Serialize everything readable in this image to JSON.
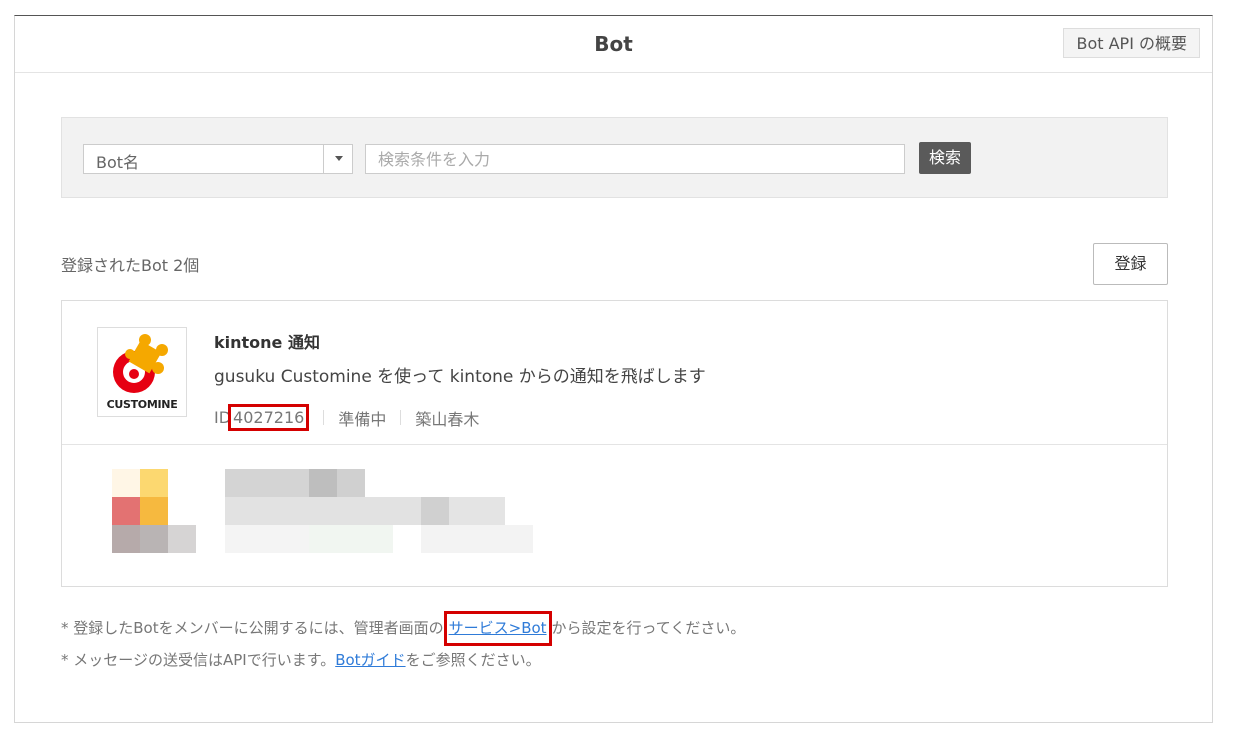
{
  "header": {
    "title": "Bot",
    "api_overview_label": "Bot API の概要"
  },
  "search": {
    "field_select_value": "Bot名",
    "input_placeholder": "検索条件を入力",
    "search_button_label": "検索"
  },
  "list": {
    "count_label": "登録されたBot 2個",
    "register_button_label": "登録",
    "bots": [
      {
        "logo_text": "CUSTOMINE",
        "name": "kintone 通知",
        "description": "gusuku Customine を使って kintone からの通知を飛ばします",
        "id_prefix": "ID",
        "id": "4027216",
        "status": "準備中",
        "owner": "築山春木"
      }
    ]
  },
  "notes": {
    "line1_prefix": "* 登録したBotをメンバーに公開するには、管理者画面の",
    "line1_link": "サービス>Bot",
    "line1_suffix": "から設定を行ってください。",
    "line2_prefix": "* メッセージの送受信はAPIで行います。",
    "line2_link": "Botガイド",
    "line2_suffix": "をご参照ください。"
  },
  "colors": {
    "highlight": "#d40000",
    "link": "#2f7bd8",
    "logo_red": "#e60012",
    "logo_yellow": "#f5a800"
  }
}
